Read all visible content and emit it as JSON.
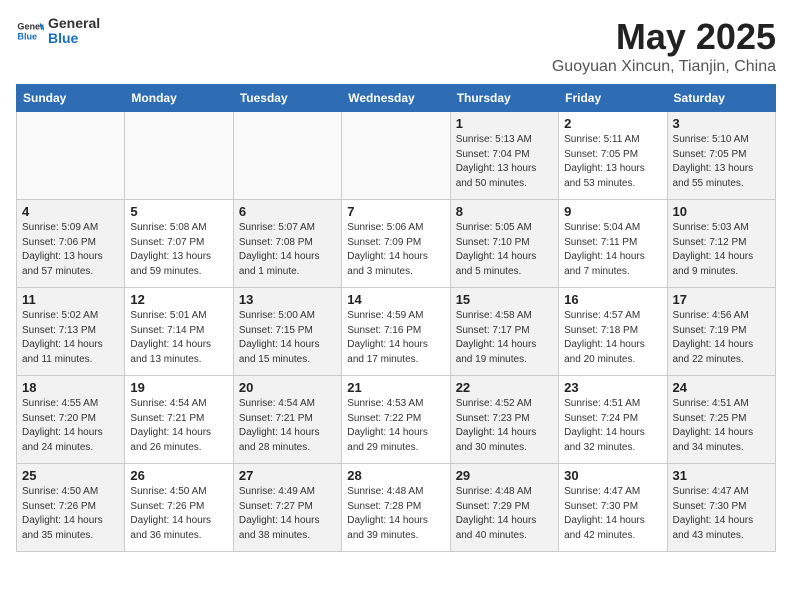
{
  "logo": {
    "general": "General",
    "blue": "Blue"
  },
  "title": "May 2025",
  "subtitle": "Guoyuan Xincun, Tianjin, China",
  "headers": [
    "Sunday",
    "Monday",
    "Tuesday",
    "Wednesday",
    "Thursday",
    "Friday",
    "Saturday"
  ],
  "weeks": [
    [
      {
        "day": "",
        "info": ""
      },
      {
        "day": "",
        "info": ""
      },
      {
        "day": "",
        "info": ""
      },
      {
        "day": "",
        "info": ""
      },
      {
        "day": "1",
        "info": "Sunrise: 5:13 AM\nSunset: 7:04 PM\nDaylight: 13 hours\nand 50 minutes."
      },
      {
        "day": "2",
        "info": "Sunrise: 5:11 AM\nSunset: 7:05 PM\nDaylight: 13 hours\nand 53 minutes."
      },
      {
        "day": "3",
        "info": "Sunrise: 5:10 AM\nSunset: 7:05 PM\nDaylight: 13 hours\nand 55 minutes."
      }
    ],
    [
      {
        "day": "4",
        "info": "Sunrise: 5:09 AM\nSunset: 7:06 PM\nDaylight: 13 hours\nand 57 minutes."
      },
      {
        "day": "5",
        "info": "Sunrise: 5:08 AM\nSunset: 7:07 PM\nDaylight: 13 hours\nand 59 minutes."
      },
      {
        "day": "6",
        "info": "Sunrise: 5:07 AM\nSunset: 7:08 PM\nDaylight: 14 hours\nand 1 minute."
      },
      {
        "day": "7",
        "info": "Sunrise: 5:06 AM\nSunset: 7:09 PM\nDaylight: 14 hours\nand 3 minutes."
      },
      {
        "day": "8",
        "info": "Sunrise: 5:05 AM\nSunset: 7:10 PM\nDaylight: 14 hours\nand 5 minutes."
      },
      {
        "day": "9",
        "info": "Sunrise: 5:04 AM\nSunset: 7:11 PM\nDaylight: 14 hours\nand 7 minutes."
      },
      {
        "day": "10",
        "info": "Sunrise: 5:03 AM\nSunset: 7:12 PM\nDaylight: 14 hours\nand 9 minutes."
      }
    ],
    [
      {
        "day": "11",
        "info": "Sunrise: 5:02 AM\nSunset: 7:13 PM\nDaylight: 14 hours\nand 11 minutes."
      },
      {
        "day": "12",
        "info": "Sunrise: 5:01 AM\nSunset: 7:14 PM\nDaylight: 14 hours\nand 13 minutes."
      },
      {
        "day": "13",
        "info": "Sunrise: 5:00 AM\nSunset: 7:15 PM\nDaylight: 14 hours\nand 15 minutes."
      },
      {
        "day": "14",
        "info": "Sunrise: 4:59 AM\nSunset: 7:16 PM\nDaylight: 14 hours\nand 17 minutes."
      },
      {
        "day": "15",
        "info": "Sunrise: 4:58 AM\nSunset: 7:17 PM\nDaylight: 14 hours\nand 19 minutes."
      },
      {
        "day": "16",
        "info": "Sunrise: 4:57 AM\nSunset: 7:18 PM\nDaylight: 14 hours\nand 20 minutes."
      },
      {
        "day": "17",
        "info": "Sunrise: 4:56 AM\nSunset: 7:19 PM\nDaylight: 14 hours\nand 22 minutes."
      }
    ],
    [
      {
        "day": "18",
        "info": "Sunrise: 4:55 AM\nSunset: 7:20 PM\nDaylight: 14 hours\nand 24 minutes."
      },
      {
        "day": "19",
        "info": "Sunrise: 4:54 AM\nSunset: 7:21 PM\nDaylight: 14 hours\nand 26 minutes."
      },
      {
        "day": "20",
        "info": "Sunrise: 4:54 AM\nSunset: 7:21 PM\nDaylight: 14 hours\nand 28 minutes."
      },
      {
        "day": "21",
        "info": "Sunrise: 4:53 AM\nSunset: 7:22 PM\nDaylight: 14 hours\nand 29 minutes."
      },
      {
        "day": "22",
        "info": "Sunrise: 4:52 AM\nSunset: 7:23 PM\nDaylight: 14 hours\nand 30 minutes."
      },
      {
        "day": "23",
        "info": "Sunrise: 4:51 AM\nSunset: 7:24 PM\nDaylight: 14 hours\nand 32 minutes."
      },
      {
        "day": "24",
        "info": "Sunrise: 4:51 AM\nSunset: 7:25 PM\nDaylight: 14 hours\nand 34 minutes."
      }
    ],
    [
      {
        "day": "25",
        "info": "Sunrise: 4:50 AM\nSunset: 7:26 PM\nDaylight: 14 hours\nand 35 minutes."
      },
      {
        "day": "26",
        "info": "Sunrise: 4:50 AM\nSunset: 7:26 PM\nDaylight: 14 hours\nand 36 minutes."
      },
      {
        "day": "27",
        "info": "Sunrise: 4:49 AM\nSunset: 7:27 PM\nDaylight: 14 hours\nand 38 minutes."
      },
      {
        "day": "28",
        "info": "Sunrise: 4:48 AM\nSunset: 7:28 PM\nDaylight: 14 hours\nand 39 minutes."
      },
      {
        "day": "29",
        "info": "Sunrise: 4:48 AM\nSunset: 7:29 PM\nDaylight: 14 hours\nand 40 minutes."
      },
      {
        "day": "30",
        "info": "Sunrise: 4:47 AM\nSunset: 7:30 PM\nDaylight: 14 hours\nand 42 minutes."
      },
      {
        "day": "31",
        "info": "Sunrise: 4:47 AM\nSunset: 7:30 PM\nDaylight: 14 hours\nand 43 minutes."
      }
    ]
  ]
}
